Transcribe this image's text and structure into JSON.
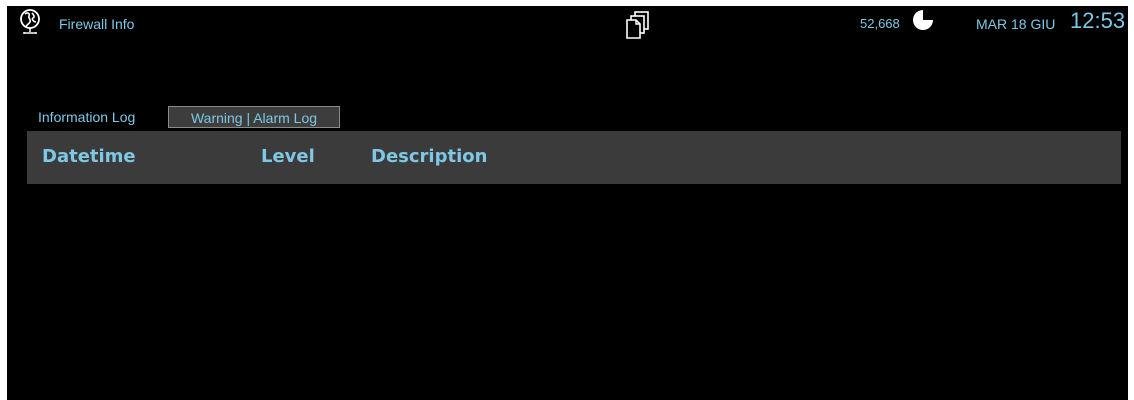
{
  "header": {
    "app_icon": "globe-icon",
    "title": "Firewall Info",
    "center_icon": "pages-icon",
    "counter": "52,668",
    "counter_icon": "moon-icon",
    "date": "MAR 18 GIU",
    "time": "12:53"
  },
  "tabs": [
    {
      "label": "Information Log",
      "selected": false
    },
    {
      "label": "Warning | Alarm Log",
      "selected": true
    }
  ],
  "table": {
    "columns": [
      "Datetime",
      "Level",
      "Description"
    ],
    "rows": []
  },
  "colors": {
    "accent": "#7ec8e6",
    "background": "#000000",
    "header_bg": "#3b3b3b"
  }
}
